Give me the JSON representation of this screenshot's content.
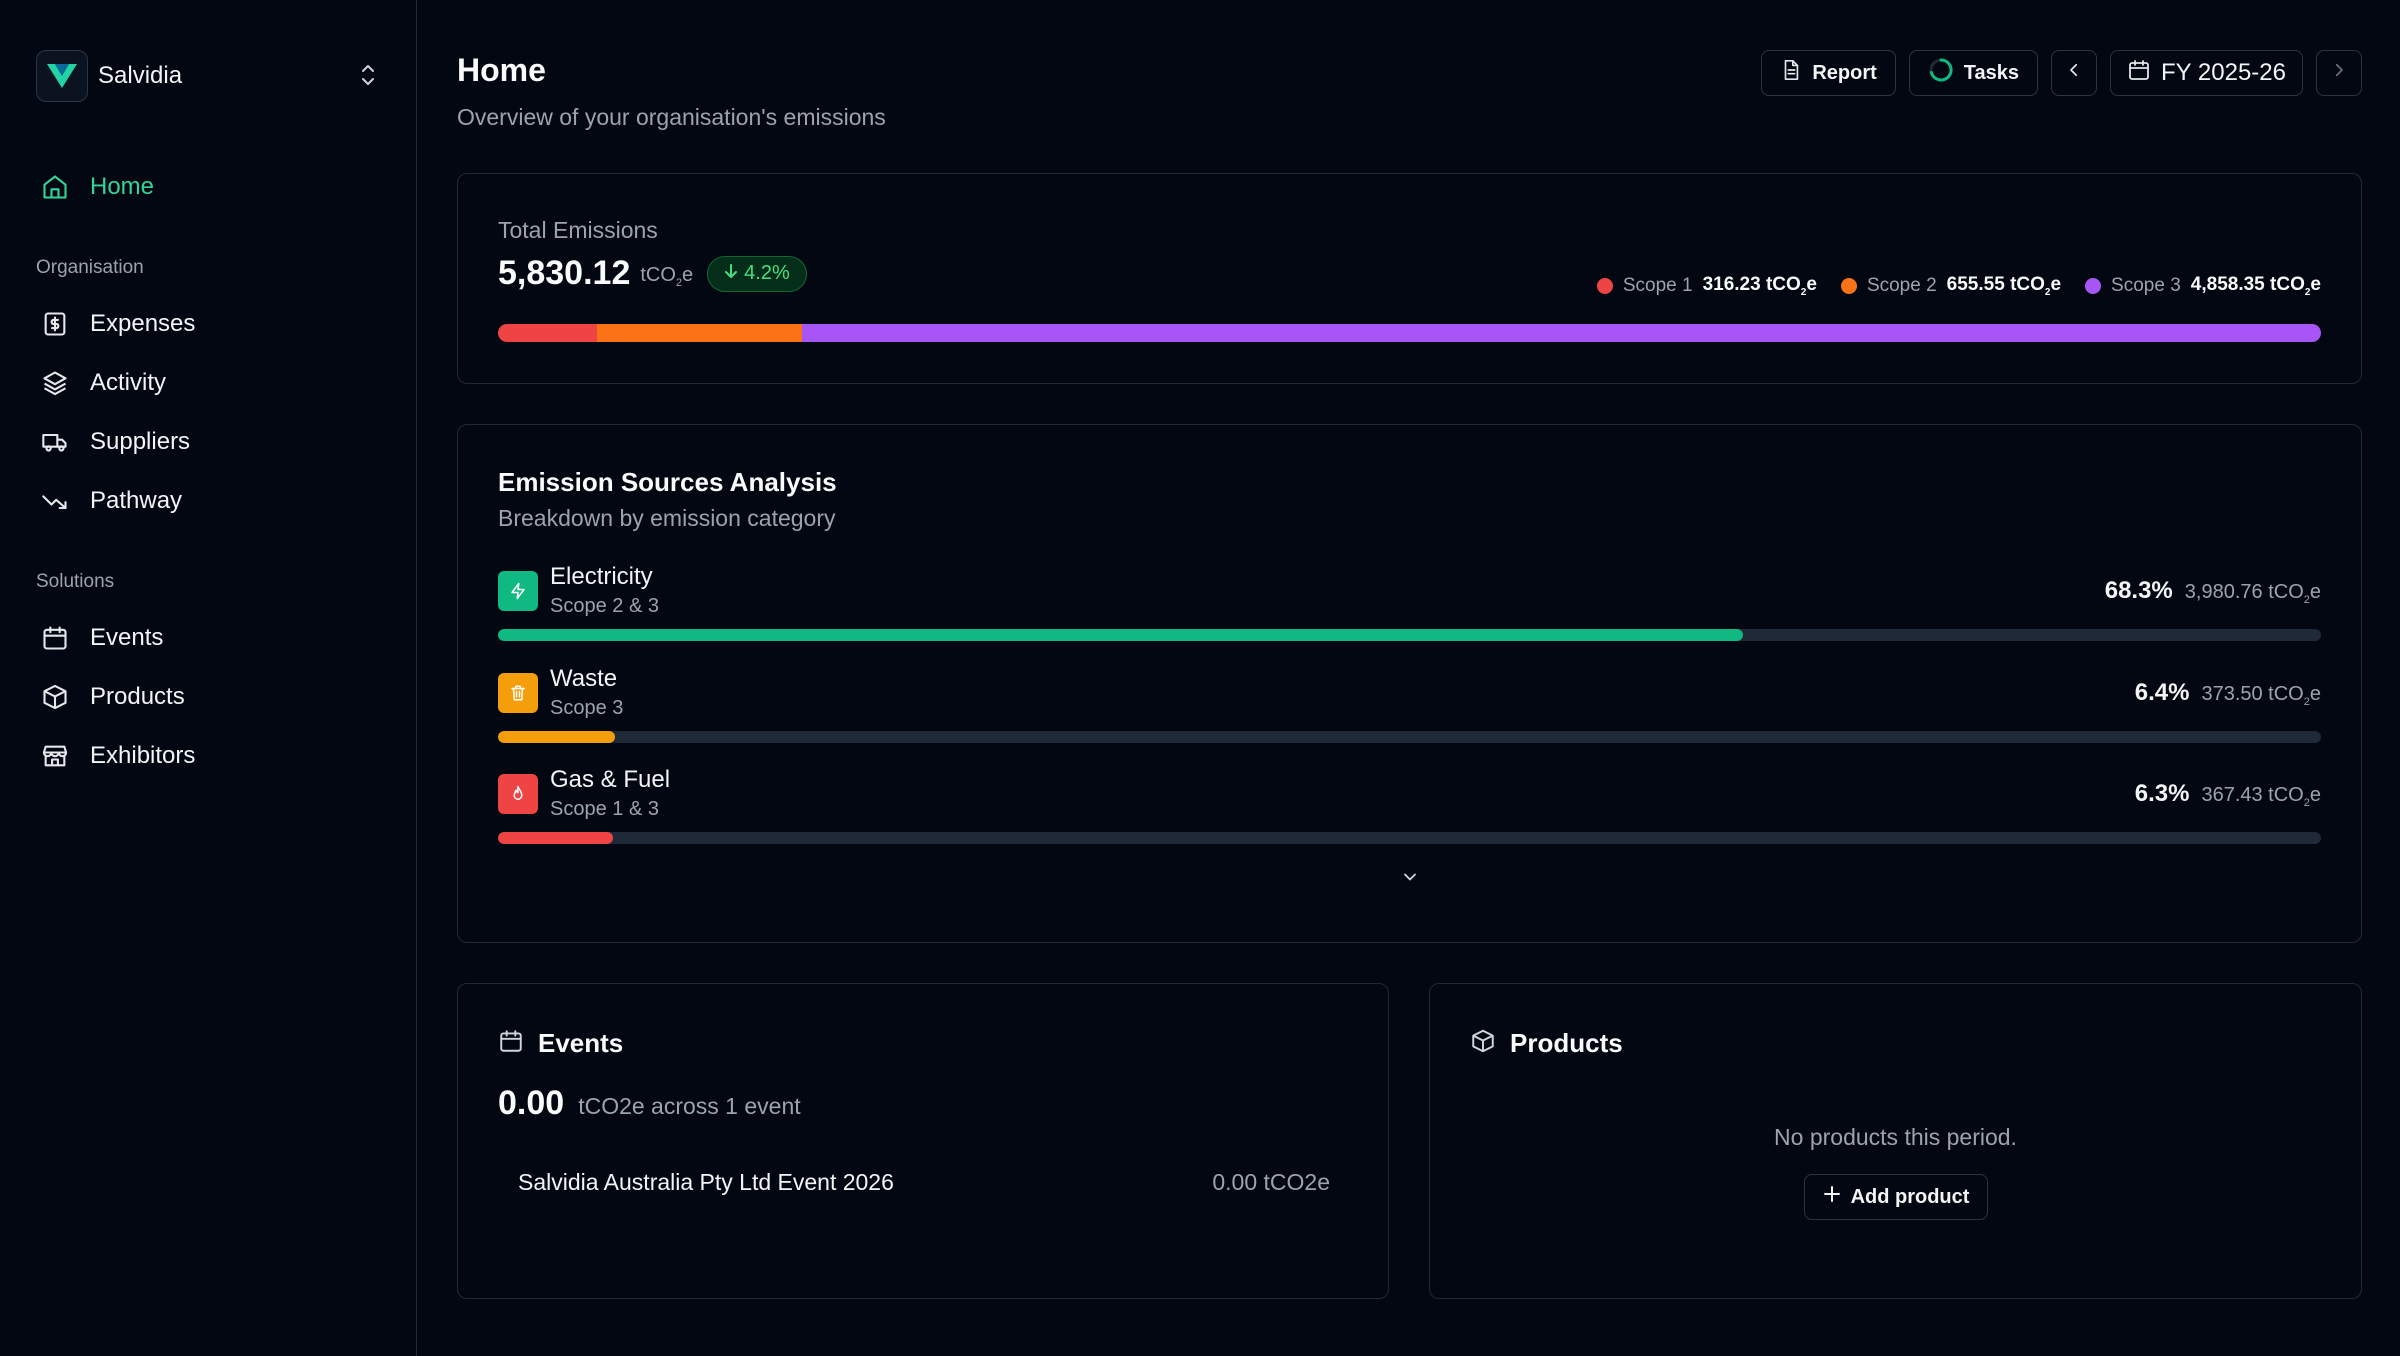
{
  "org": {
    "name": "Salvidia"
  },
  "nav": {
    "home": "Home",
    "sections": {
      "organisation": "Organisation",
      "solutions": "Solutions"
    },
    "organisation_items": [
      "Expenses",
      "Activity",
      "Suppliers",
      "Pathway"
    ],
    "solutions_items": [
      "Events",
      "Products",
      "Exhibitors"
    ]
  },
  "header": {
    "title": "Home",
    "subtitle": "Overview of your organisation's emissions",
    "report_label": "Report",
    "tasks_label": "Tasks",
    "period_label": "FY 2025-26"
  },
  "total": {
    "label": "Total Emissions",
    "value": "5,830.12",
    "unit": "tCO",
    "unit_sub": "2",
    "unit_suffix": "e",
    "change": "4.2%",
    "scopes": [
      {
        "name": "Scope 1",
        "value": "316.23 tCO",
        "share": 5.42,
        "color": "#ef4444"
      },
      {
        "name": "Scope 2",
        "value": "655.55 tCO",
        "share": 11.24,
        "color": "#f97316"
      },
      {
        "name": "Scope 3",
        "value": "4,858.35 tCO",
        "share": 83.34,
        "color": "#a855f7"
      }
    ]
  },
  "sources": {
    "title": "Emission Sources Analysis",
    "subtitle": "Breakdown by emission category",
    "items": [
      {
        "name": "Electricity",
        "scope": "Scope 2 & 3",
        "pct": "68.3%",
        "amount": "3,980.76 tCO",
        "share": 68.3,
        "color": "#10b981",
        "icon": "lightning-icon"
      },
      {
        "name": "Waste",
        "scope": "Scope 3",
        "pct": "6.4%",
        "amount": "373.50 tCO",
        "share": 6.4,
        "color": "#f59e0b",
        "icon": "trash-icon"
      },
      {
        "name": "Gas & Fuel",
        "scope": "Scope 1 & 3",
        "pct": "6.3%",
        "amount": "367.43 tCO",
        "share": 6.3,
        "color": "#ef4444",
        "icon": "flame-icon"
      }
    ]
  },
  "events": {
    "title": "Events",
    "total_value": "0.00",
    "total_text": "tCO2e across 1 event",
    "rows": [
      {
        "name": "Salvidia Australia Pty Ltd Event 2026",
        "value": "0.00 tCO2e"
      }
    ]
  },
  "products": {
    "title": "Products",
    "empty_text": "No products this period.",
    "add_label": "Add product"
  },
  "colors": {
    "accent": "#34d399",
    "background": "#030712",
    "border": "#1f2937"
  }
}
